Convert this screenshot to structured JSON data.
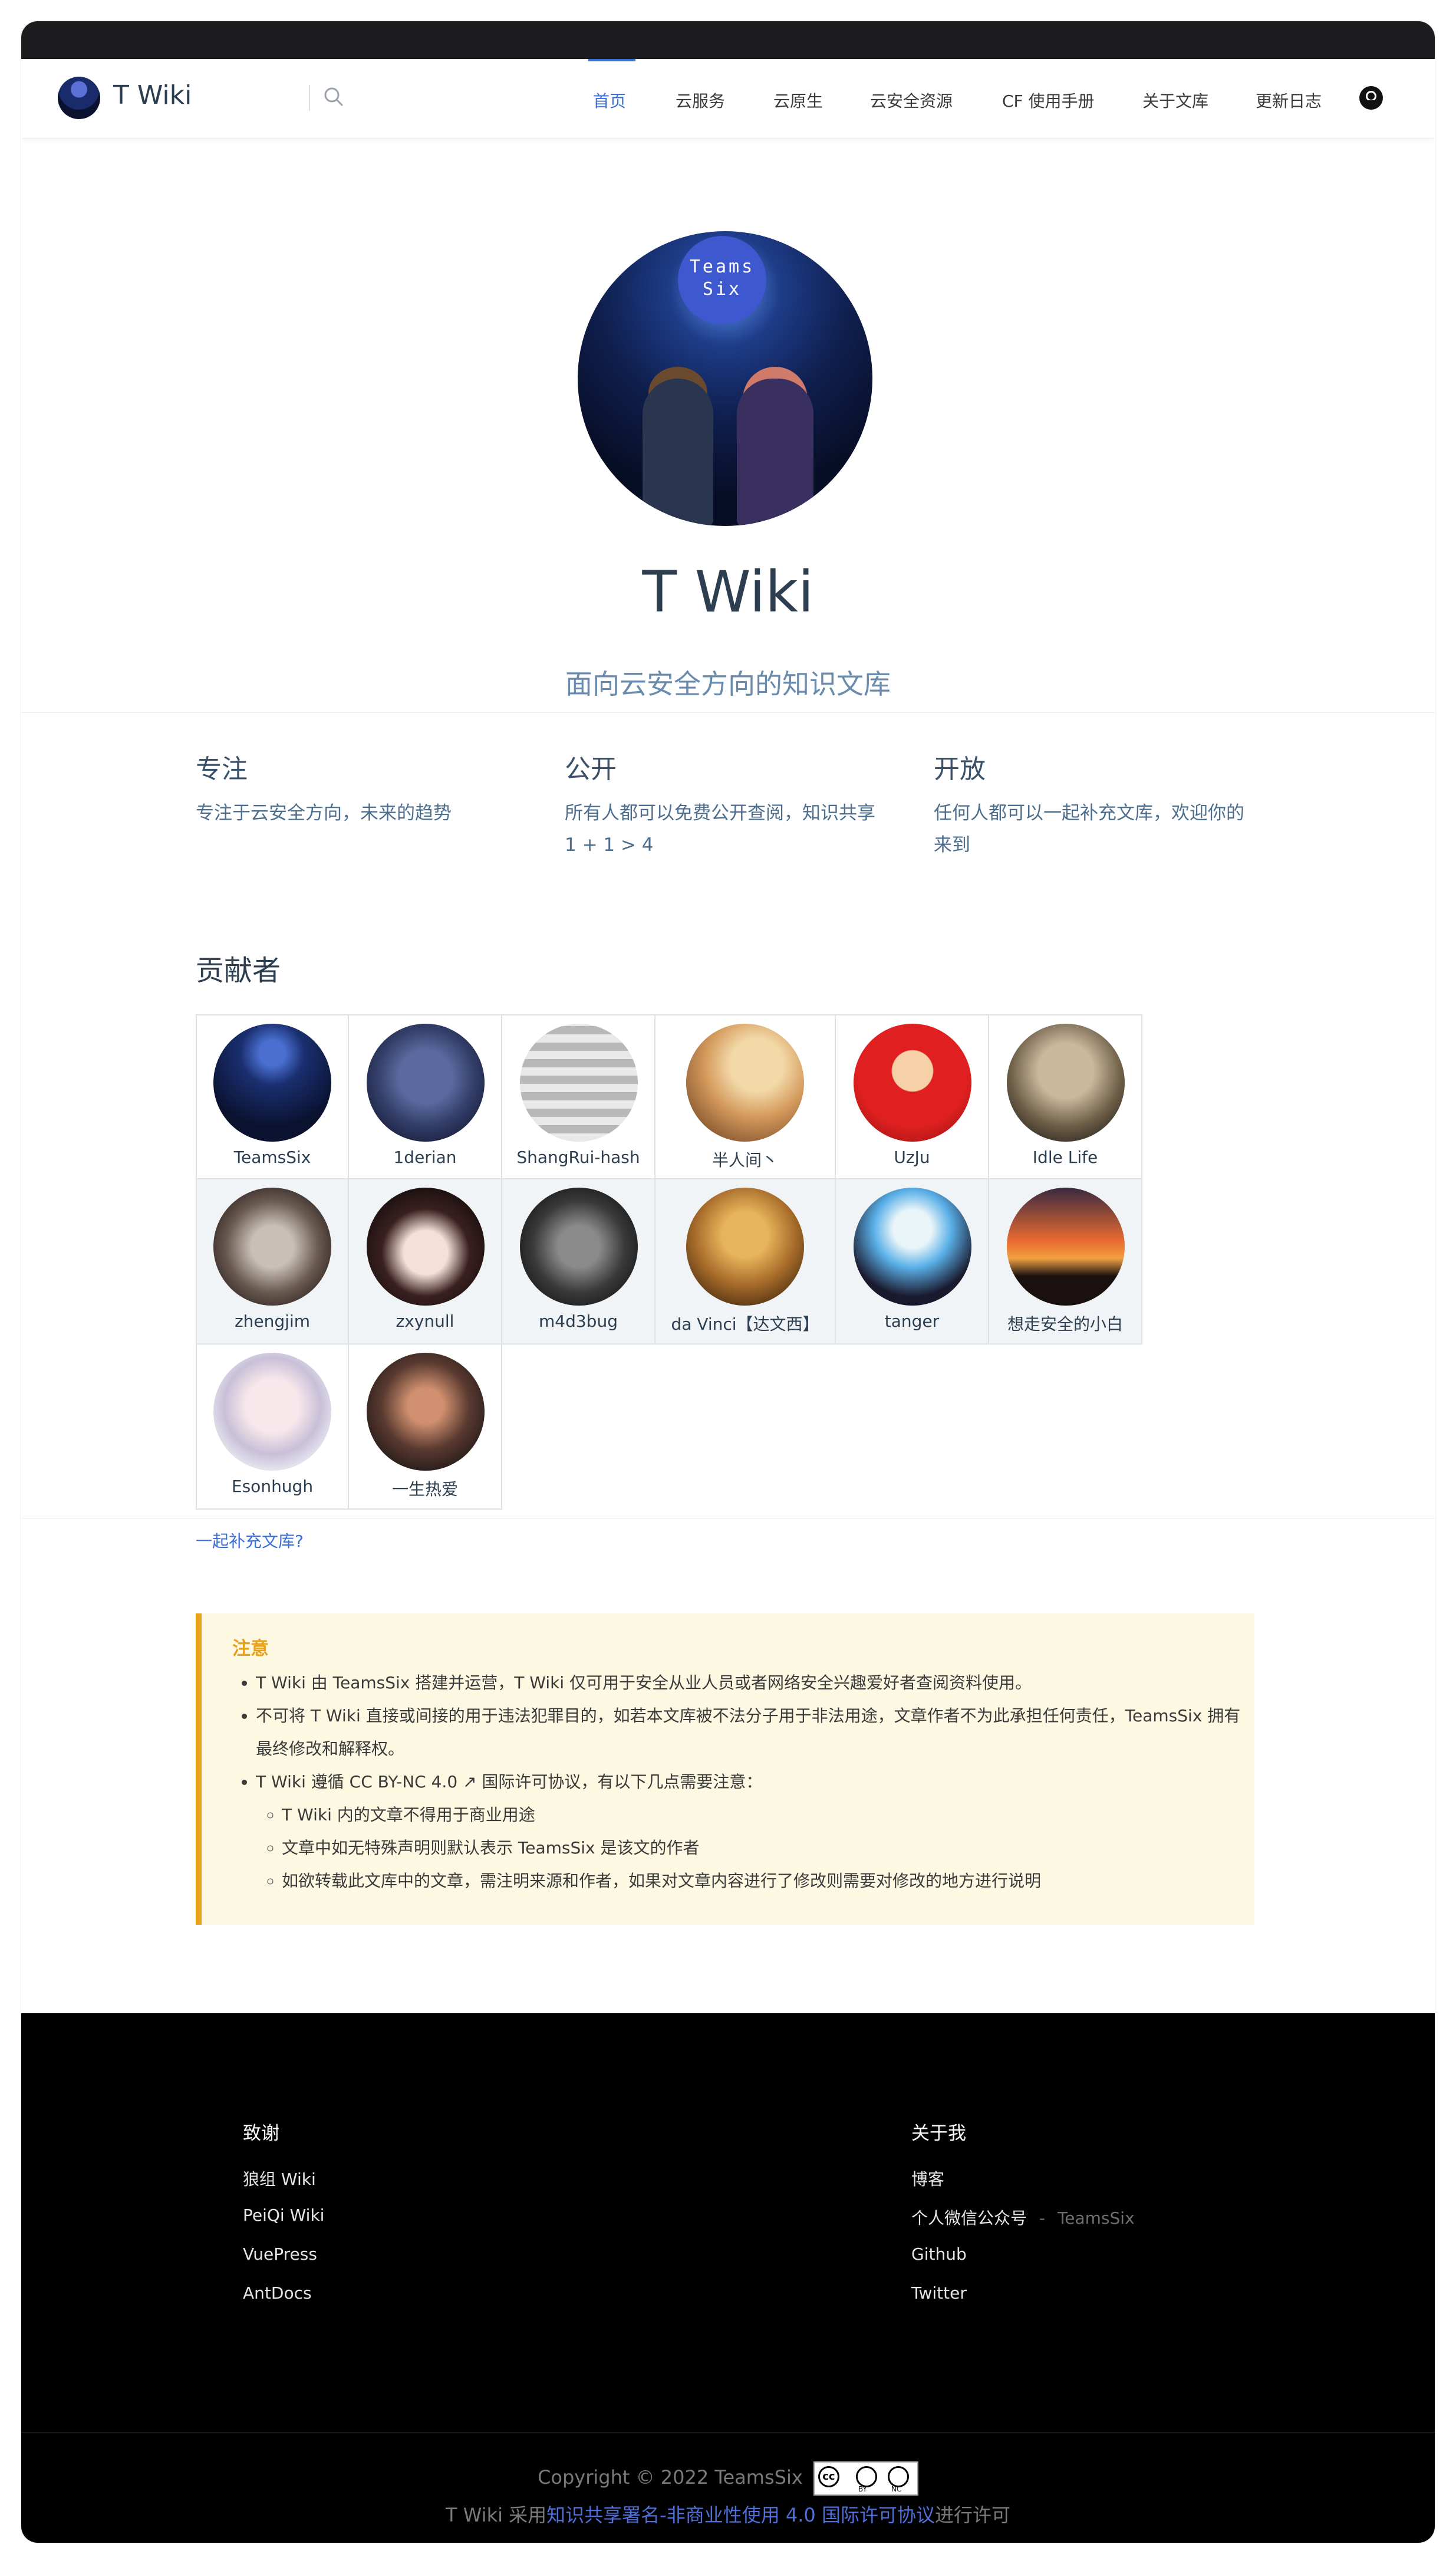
{
  "site": {
    "brand": "T Wiki"
  },
  "nav": {
    "items": [
      "首页",
      "云服务",
      "云原生",
      "云安全资源",
      "CF 使用手册",
      "关于文库",
      "更新日志"
    ],
    "active_index": 0
  },
  "hero": {
    "badge_line1": "Teams",
    "badge_line2": "Six",
    "title": "T Wiki",
    "description": "面向云安全方向的知识文库"
  },
  "features": [
    {
      "title": "专注",
      "text": "专注于云安全方向，未来的趋势"
    },
    {
      "title": "公开",
      "text": "所有人都可以免费公开查阅，知识共享 1 + 1 > 4"
    },
    {
      "title": "开放",
      "text": "任何人都可以一起补充文库，欢迎你的来到"
    }
  ],
  "contributors": {
    "heading": "贡献者",
    "people": [
      "TeamsSix",
      "1derian",
      "ShangRui-hash",
      "半人间丶",
      "UzJu",
      "Idle Life",
      "zhengjim",
      "zxynull",
      "m4d3bug",
      "da Vinci【达文西】",
      "tanger",
      "想走安全的小白",
      "Esonhugh",
      "一生热爱"
    ],
    "more_link": "一起补充文库?"
  },
  "notice": {
    "title": "注意",
    "items": [
      "T Wiki 由 TeamsSix 搭建并运营，T Wiki 仅可用于安全从业人员或者网络安全兴趣爱好者查阅资料使用。",
      "不可将 T Wiki 直接或间接的用于违法犯罪目的，如若本文库被不法分子用于非法用途，文章作者不为此承担任何责任，TeamsSix 拥有最终修改和解释权。",
      "T Wiki 遵循 CC BY-NC 4.0 ↗ 国际许可协议，有以下几点需要注意："
    ],
    "subitems": [
      "T Wiki 内的文章不得用于商业用途",
      "文章中如无特殊声明则默认表示 TeamsSix 是该文的作者",
      "如欲转载此文库中的文章，需注明来源和作者，如果对文章内容进行了修改则需要对修改的地方进行说明"
    ]
  },
  "footer": {
    "thanks_title": "致谢",
    "thanks_links": [
      "狼组 Wiki",
      "PeiQi Wiki",
      "VuePress",
      "AntDocs"
    ],
    "about_title": "关于我",
    "about_links": [
      "博客",
      "个人微信公众号",
      "Github",
      "Twitter"
    ],
    "wechat_sep": "-",
    "wechat_name": "TeamsSix",
    "copyright": "Copyright © 2022 TeamsSix",
    "cc_by": "BY",
    "cc_nc": "NC",
    "license_prefix": "T Wiki 采用",
    "license_link": "知识共享署名-非商业性使用 4.0 国际许可协议",
    "license_suffix": "进行许可"
  },
  "colors": {
    "accent": "#3b6fd8",
    "warning": "#e7a11b",
    "notice_bg": "#fdf8e1",
    "footer_bg": "#000000"
  }
}
